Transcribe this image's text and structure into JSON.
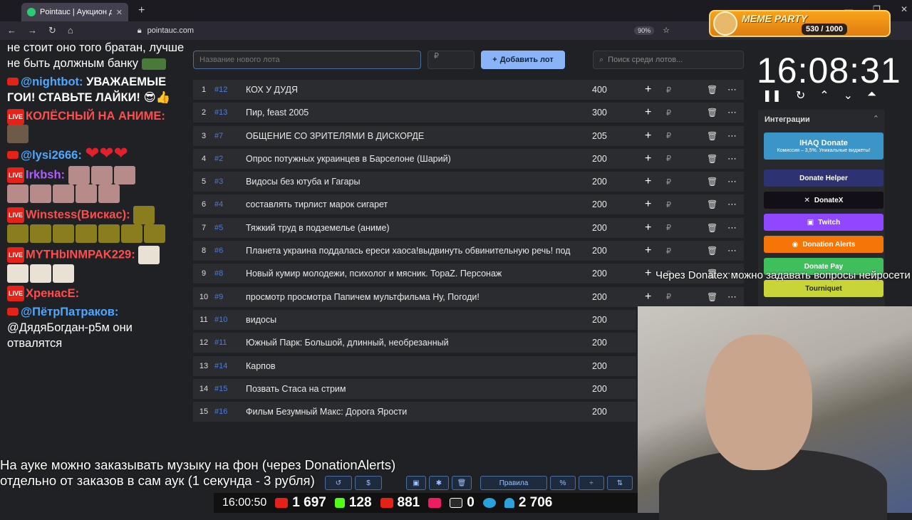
{
  "browser": {
    "tab_title": "Pointauc | Аукцион для стрим",
    "url": "pointauc.com",
    "zoom": "90%"
  },
  "meme_party": {
    "title": "MEME PARTY",
    "score": "530 / 1000"
  },
  "chat": [
    {
      "text": "не стоит оно того братан, лучше не быть должным банку"
    },
    {
      "nick": "@nightbot:",
      "nick_color": "#4fa8ff",
      "text": "УВАЖАЕМЫЕ ГОИ! СТАВЬТЕ ЛАЙКИ!"
    },
    {
      "nick": "КОЛЁСНЫЙ НА АНИМЕ:",
      "nick_color": "#ff4d4d"
    },
    {
      "nick": "@lysi2666:",
      "nick_color": "#4fa8ff",
      "text": "❤❤❤"
    },
    {
      "nick": "Irkbsh:",
      "nick_color": "#b15cff"
    },
    {
      "nick": "Winstess(Вискас):",
      "nick_color": "#ff4d4d"
    },
    {
      "nick": "MYTHbINMPAK229:",
      "nick_color": "#ff4d4d"
    },
    {
      "nick": "ХренасЕ:",
      "nick_color": "#ff4d4d"
    },
    {
      "nick": "@ПётрПатраков:",
      "nick_color": "#4fa8ff",
      "text": "@ДядяБогдан-р5м они отвалятся"
    }
  ],
  "controls": {
    "lot_name_placeholder": "Название нового лота",
    "amount_placeholder": "₽",
    "add_lot_label": "Добавить лот",
    "search_placeholder": "Поиск среди лотов..."
  },
  "lots": [
    {
      "n": "1",
      "id": "#12",
      "name": "КОХ У ДУДЯ",
      "amount": "400"
    },
    {
      "n": "2",
      "id": "#13",
      "name": "Пир, feast 2005",
      "amount": "300"
    },
    {
      "n": "3",
      "id": "#7",
      "name": "ОБЩЕНИЕ СО ЗРИТЕЛЯМИ В ДИСКОРДЕ",
      "amount": "205"
    },
    {
      "n": "4",
      "id": "#2",
      "name": "Опрос потужных украинцев в Барселоне (Шарий)",
      "amount": "200"
    },
    {
      "n": "5",
      "id": "#3",
      "name": "Видосы без ютуба и Гагары",
      "amount": "200"
    },
    {
      "n": "6",
      "id": "#4",
      "name": "составлять тирлист марок сигарет",
      "amount": "200"
    },
    {
      "n": "7",
      "id": "#5",
      "name": "Тяжкий труд в подземелье (аниме)",
      "amount": "200"
    },
    {
      "n": "8",
      "id": "#6",
      "name": "Планета украина поддалась ереси хаоса!выдвинуть обвинительную речь! под",
      "amount": "200"
    },
    {
      "n": "9",
      "id": "#8",
      "name": "Новый кумир молодежи, психолог и мясник. TopaZ. Персонаж",
      "amount": "200"
    },
    {
      "n": "10",
      "id": "#9",
      "name": "просмотр просмотра Папичем мультфильма Ну, Погоди!",
      "amount": "200"
    },
    {
      "n": "11",
      "id": "#10",
      "name": "видосы",
      "amount": "200"
    },
    {
      "n": "12",
      "id": "#11",
      "name": "Южный Парк: Большой, длинный, необрезанный",
      "amount": "200"
    },
    {
      "n": "13",
      "id": "#14",
      "name": "Карпов",
      "amount": "200"
    },
    {
      "n": "14",
      "id": "#15",
      "name": "Позвать Стаса на стрим",
      "amount": "200"
    },
    {
      "n": "15",
      "id": "#16",
      "name": "Фильм Безумный Макс: Дорога Ярости",
      "amount": "200"
    }
  ],
  "timer": "16:08:31",
  "integrations": {
    "title": "Интеграции",
    "ihaq_title": "IHAQ Donate",
    "ihaq_sub": "Комиссия – 3,5%. Уникальные виджеты!",
    "items": [
      "Donate Helper",
      "DonateX",
      "Twitch",
      "Donation Alerts",
      "Donate Pay",
      "Tourniquet"
    ]
  },
  "overlay_donatex": "Через Donatex можно задавать вопросы нейросети",
  "overlay_music": [
    "На ауке можно заказывать музыку на фон (через DonationAlerts)",
    "отдельно от заказов в сам аук (1 секунда - 3 рубля)"
  ],
  "toolbar": {
    "rules_label": "Правила"
  },
  "stats": {
    "clock": "16:00:50",
    "youtube": "1 697",
    "kick": "128",
    "vk": "881",
    "rutube": "0",
    "total": "2 706"
  }
}
